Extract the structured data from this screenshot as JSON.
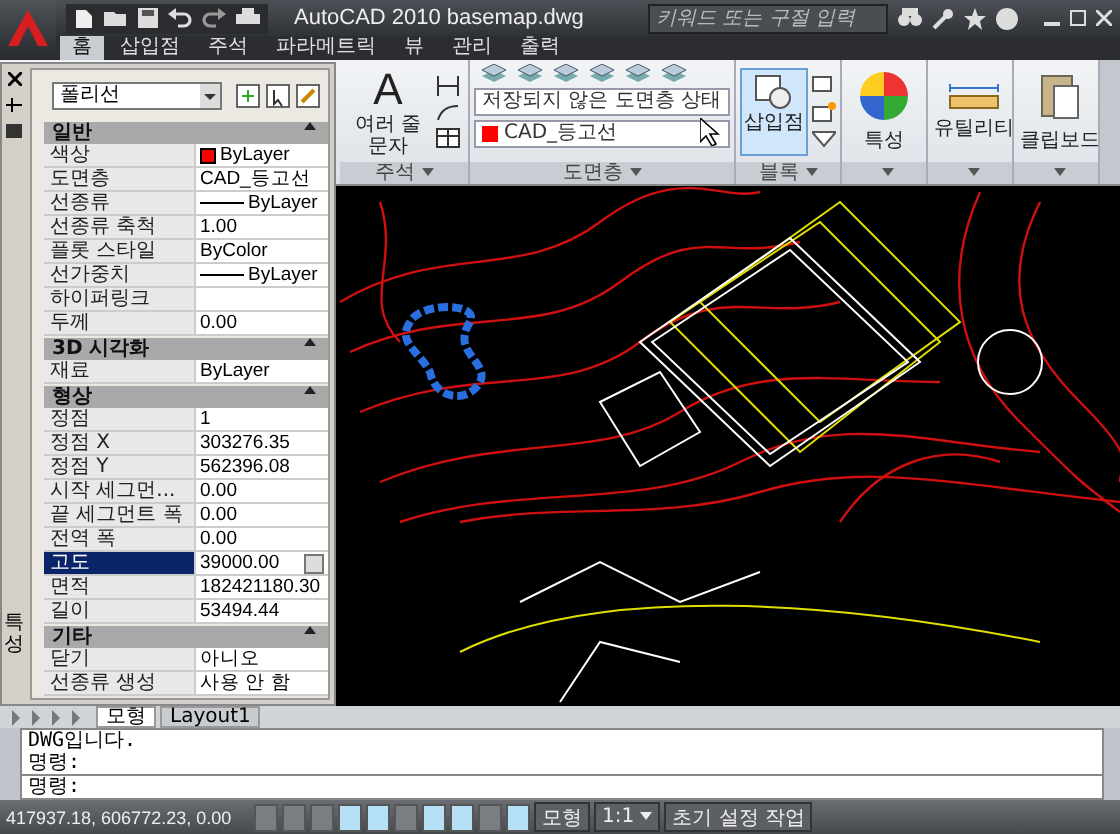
{
  "window": {
    "title": "AutoCAD 2010   basemap.dwg",
    "search": {
      "placeholder": "키워드 또는 구절 입력"
    }
  },
  "ribbon_tabs": [
    {
      "label": "홈",
      "selected": true
    },
    {
      "label": "삽입점",
      "selected": false
    },
    {
      "label": "주석",
      "selected": false
    },
    {
      "label": "파라메트릭",
      "selected": false
    },
    {
      "label": "뷰",
      "selected": false
    },
    {
      "label": "관리",
      "selected": false
    },
    {
      "label": "출력",
      "selected": false
    }
  ],
  "ribbon": {
    "annotation": {
      "icon_letter": "A",
      "button": "여러 줄 문자",
      "footer": "주석"
    },
    "layers": {
      "state_combo": "저장되지 않은 도면층 상태",
      "layer_combo": {
        "label": "CAD_등고선",
        "color": "#ff0000"
      },
      "footer": "도면층"
    },
    "block": {
      "button": "삽입점",
      "footer": "블록"
    },
    "big_buttons": [
      {
        "kind": "palette",
        "label": "특성"
      },
      {
        "kind": "ruler",
        "label": "유틸리티"
      },
      {
        "kind": "clipboard",
        "label": "클립보드"
      }
    ]
  },
  "properties": {
    "object_type": "폴리선",
    "side_label": "특성",
    "sections": [
      {
        "title": "일반",
        "rows": [
          {
            "label": "색상",
            "value": "ByLayer",
            "kind": "color",
            "color": "#ff0000",
            "selected": false
          },
          {
            "label": "도면층",
            "value": "CAD_등고선",
            "kind": "text",
            "selected": false
          },
          {
            "label": "선종류",
            "value": "ByLayer",
            "kind": "line",
            "selected": false
          },
          {
            "label": "선종류 축척",
            "value": "1.00",
            "kind": "text",
            "selected": false
          },
          {
            "label": "플롯 스타일",
            "value": "ByColor",
            "kind": "text",
            "selected": false
          },
          {
            "label": "선가중치",
            "value": "ByLayer",
            "kind": "line",
            "selected": false
          },
          {
            "label": "하이퍼링크",
            "kind": "text",
            "selected": false
          },
          {
            "label": "두께",
            "value": "0.00",
            "kind": "text",
            "selected": false
          }
        ]
      },
      {
        "title": "3D 시각화",
        "rows": [
          {
            "label": "재료",
            "value": "ByLayer",
            "kind": "text",
            "selected": false
          }
        ]
      },
      {
        "title": "형상",
        "rows": [
          {
            "label": "정점",
            "value": "1",
            "kind": "text",
            "selected": false
          },
          {
            "label": "정점 X",
            "value": "303276.35",
            "kind": "text",
            "selected": false
          },
          {
            "label": "정점 Y",
            "value": "562396.08",
            "kind": "text",
            "selected": false
          },
          {
            "label": "시작 세그먼...",
            "value": "0.00",
            "kind": "text",
            "selected": false
          },
          {
            "label": "끝 세그먼트 폭",
            "value": "0.00",
            "kind": "text",
            "selected": false
          },
          {
            "label": "전역 폭",
            "value": "0.00",
            "kind": "text",
            "selected": false
          },
          {
            "label": "고도",
            "value": "39000.00",
            "kind": "text",
            "selected": true
          },
          {
            "label": "면적",
            "value": "182421180.30",
            "kind": "text",
            "selected": false
          },
          {
            "label": "길이",
            "value": "53494.44",
            "kind": "text",
            "selected": false
          }
        ]
      },
      {
        "title": "기타",
        "rows": [
          {
            "label": "닫기",
            "value": "아니오",
            "kind": "text",
            "selected": false
          },
          {
            "label": "선종류 생성",
            "value": "사용 안 함",
            "kind": "text",
            "selected": false
          }
        ]
      }
    ]
  },
  "layout_tabs": [
    {
      "label": "모형",
      "selected": true
    },
    {
      "label": "Layout1",
      "selected": false
    }
  ],
  "command": {
    "history": [
      "DWG입니다.",
      "명령:"
    ],
    "prompt": "명령:"
  },
  "status_bar": {
    "coordinates": "417937.18, 606772.23, 0.00",
    "toggles": [
      {
        "on": false
      },
      {
        "on": false
      },
      {
        "on": false
      },
      {
        "on": true
      },
      {
        "on": true
      },
      {
        "on": false
      },
      {
        "on": true
      },
      {
        "on": true
      },
      {
        "on": false
      },
      {
        "on": true
      }
    ],
    "model": "모형",
    "scale": "1:1",
    "workspace": "초기 설정 작업"
  }
}
